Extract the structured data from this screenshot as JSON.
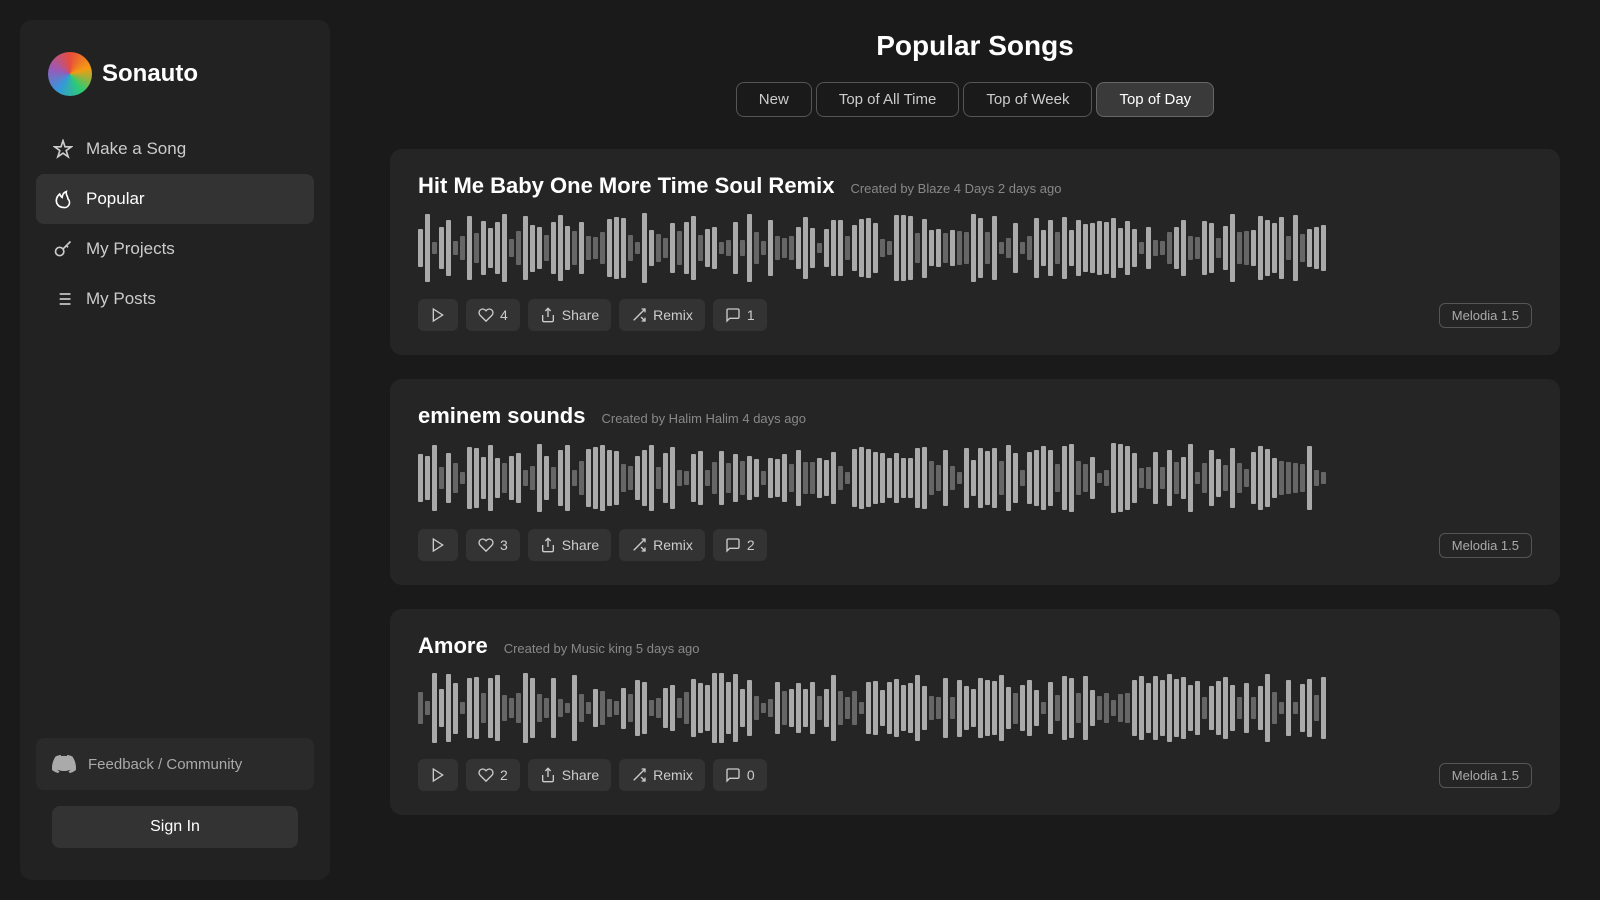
{
  "app": {
    "name": "Sonauto"
  },
  "sidebar": {
    "nav_items": [
      {
        "id": "make-song",
        "label": "Make a Song",
        "icon": "sparkle",
        "active": false
      },
      {
        "id": "popular",
        "label": "Popular",
        "icon": "fire",
        "active": true
      },
      {
        "id": "my-projects",
        "label": "My Projects",
        "icon": "key",
        "active": false
      },
      {
        "id": "my-posts",
        "label": "My Posts",
        "icon": "list",
        "active": false
      }
    ],
    "feedback_label": "Feedback / Community",
    "sign_in_label": "Sign In"
  },
  "main": {
    "page_title": "Popular Songs",
    "tabs": [
      {
        "id": "new",
        "label": "New",
        "active": false
      },
      {
        "id": "top-all-time",
        "label": "Top of All Time",
        "active": false
      },
      {
        "id": "top-week",
        "label": "Top of Week",
        "active": false
      },
      {
        "id": "top-day",
        "label": "Top of Day",
        "active": true
      }
    ],
    "songs": [
      {
        "id": "song-1",
        "title": "Hit Me Baby One More Time Soul Remix",
        "meta": "Created by Blaze 4 Days 2 days ago",
        "likes": 4,
        "comments": 1,
        "model": "Melodia 1.5",
        "share_label": "Share",
        "remix_label": "Remix"
      },
      {
        "id": "song-2",
        "title": "eminem sounds",
        "meta": "Created by Halim Halim 4 days ago",
        "likes": 3,
        "comments": 2,
        "model": "Melodia 1.5",
        "share_label": "Share",
        "remix_label": "Remix"
      },
      {
        "id": "song-3",
        "title": "Amore",
        "meta": "Created by Music king 5 days ago",
        "likes": 2,
        "comments": 0,
        "model": "Melodia 1.5",
        "share_label": "Share",
        "remix_label": "Remix"
      }
    ]
  }
}
